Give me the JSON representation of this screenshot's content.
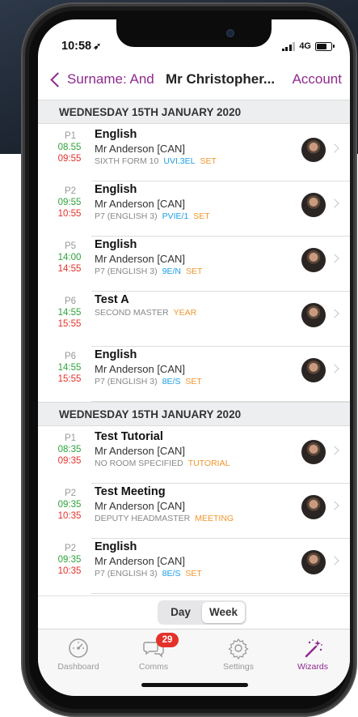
{
  "status_bar": {
    "time": "10:58",
    "network": "4G"
  },
  "nav": {
    "back_label": "Surname: And",
    "title": "Mr Christopher...",
    "account_label": "Account"
  },
  "sections": [
    {
      "header": "WEDNESDAY 15TH JANUARY 2020",
      "lessons": [
        {
          "period": "P1",
          "start": "08.55",
          "end": "09:55",
          "subject": "English",
          "teacher": "Mr Anderson [CAN]",
          "location": "SIXTH FORM 10",
          "class": "UVI.3EL",
          "type": "SET"
        },
        {
          "period": "P2",
          "start": "09:55",
          "end": "10:55",
          "subject": "English",
          "teacher": "Mr Anderson [CAN]",
          "location": "P7 (ENGLISH 3)",
          "class": "PVIE/1",
          "type": "SET"
        },
        {
          "period": "P5",
          "start": "14:00",
          "end": "14:55",
          "subject": "English",
          "teacher": "Mr Anderson [CAN]",
          "location": "P7 (ENGLISH 3)",
          "class": "9E/N",
          "type": "SET"
        },
        {
          "period": "P6",
          "start": "14:55",
          "end": "15:55",
          "subject": "Test A",
          "teacher": "",
          "location": "SECOND MASTER",
          "class": "",
          "type": "YEAR"
        },
        {
          "period": "P6",
          "start": "14:55",
          "end": "15:55",
          "subject": "English",
          "teacher": "Mr Anderson [CAN]",
          "location": "P7 (ENGLISH 3)",
          "class": "8E/S",
          "type": "SET"
        }
      ]
    },
    {
      "header": "WEDNESDAY 15TH JANUARY 2020",
      "lessons": [
        {
          "period": "P1",
          "start": "08:35",
          "end": "09:35",
          "subject": "Test Tutorial",
          "teacher": "Mr Anderson [CAN]",
          "location": "NO ROOM SPECIFIED",
          "class": "",
          "type": "TUTORIAL"
        },
        {
          "period": "P2",
          "start": "09:35",
          "end": "10:35",
          "subject": "Test Meeting",
          "teacher": "Mr Anderson [CAN]",
          "location": "DEPUTY HEADMASTER",
          "class": "",
          "type": "MEETING"
        },
        {
          "period": "P2",
          "start": "09:35",
          "end": "10:35",
          "subject": "English",
          "teacher": "Mr Anderson [CAN]",
          "location": "P7 (ENGLISH 3)",
          "class": "8E/S",
          "type": "SET"
        }
      ]
    }
  ],
  "view_toggle": {
    "day_label": "Day",
    "week_label": "Week",
    "selected": "Week"
  },
  "tab_bar": {
    "dashboard_label": "Dashboard",
    "comms_label": "Comms",
    "comms_badge": "29",
    "settings_label": "Settings",
    "wizards_label": "Wizards",
    "active": "Wizards"
  },
  "colors": {
    "accent": "#8e2a8e",
    "start_time": "#2ea33a",
    "end_time": "#e4322b",
    "class_code": "#1a9ee6",
    "type_tag": "#f0962e",
    "badge": "#e4322b"
  }
}
